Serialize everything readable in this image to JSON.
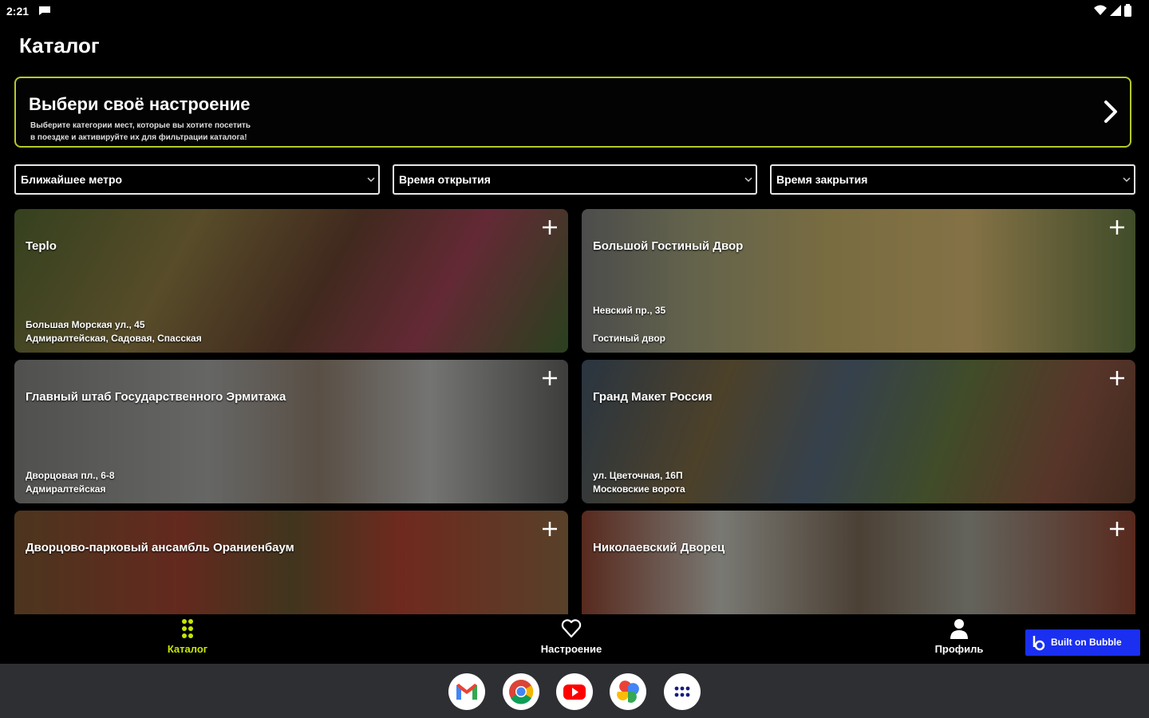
{
  "status": {
    "time": "2:21"
  },
  "page": {
    "title": "Каталог"
  },
  "mood": {
    "title": "Выбери своё настроение",
    "desc_line1": "Выберите категории мест, которые вы хотите посетить",
    "desc_line2": "в поездке и активируйте их для фильтрации каталога!"
  },
  "filters": [
    {
      "label": "Ближайшее метро"
    },
    {
      "label": "Время открытия"
    },
    {
      "label": "Время закрытия"
    }
  ],
  "cards": [
    {
      "title": "Teplo",
      "address": "Большая Морская ул., 45",
      "metro": "Адмиралтейская, Садовая, Спасская"
    },
    {
      "title": "Большой Гостиный Двор",
      "address": "Невский пр., 35",
      "metro": "Гостиный двор"
    },
    {
      "title": "Главный штаб Государственного Эрмитажа",
      "address": "Дворцовая пл., 6-8",
      "metro": "Адмиралтейская"
    },
    {
      "title": "Гранд Макет Россия",
      "address": "ул. Цветочная, 16П",
      "metro": "Московские ворота"
    },
    {
      "title": "Дворцово-парковый ансамбль Ораниенбаум",
      "address": "",
      "metro": ""
    },
    {
      "title": "Николаевский Дворец",
      "address": "",
      "metro": ""
    }
  ],
  "nav": {
    "catalog": "Каталог",
    "mood": "Настроение",
    "profile": "Профиль"
  },
  "bubble": {
    "label": "Built on Bubble"
  },
  "dock": [
    "gmail-icon",
    "chrome-icon",
    "youtube-icon",
    "photos-icon",
    "app-drawer-icon"
  ],
  "colors": {
    "accent": "#c8e600",
    "banner_border": "#b5c92b",
    "bubble": "#1a2ff0",
    "taskbar": "#2e2f33"
  }
}
